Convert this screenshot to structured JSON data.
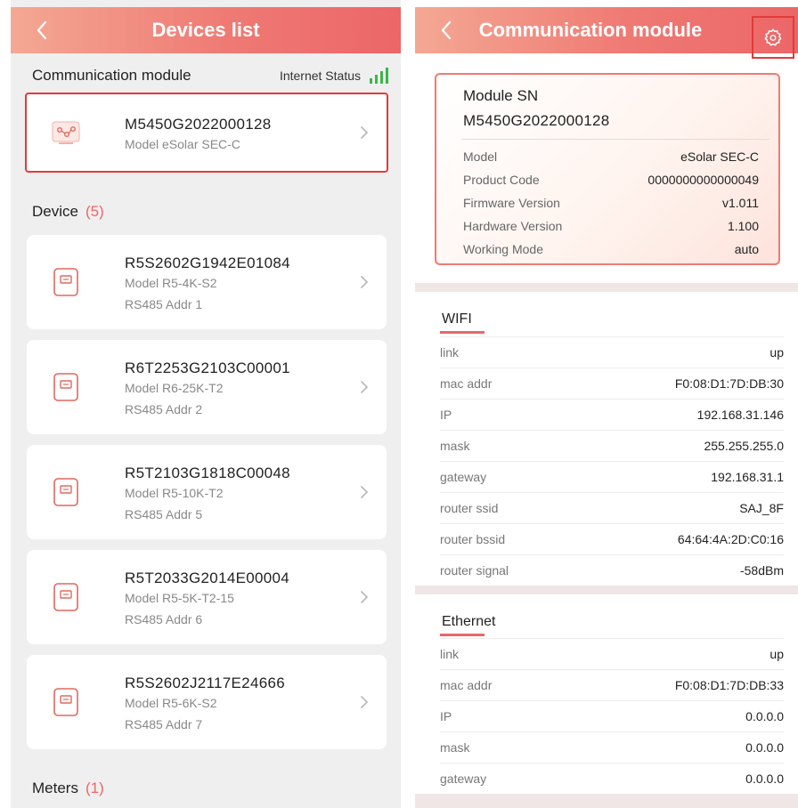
{
  "left": {
    "header": {
      "title": "Devices list"
    },
    "comm_section": {
      "title": "Communication module",
      "internet_status_label": "Internet Status"
    },
    "module": {
      "sn": "M5450G2022000128",
      "model": "Model  eSolar SEC-C"
    },
    "device_section": {
      "label": "Device",
      "count": "(5)"
    },
    "devices": [
      {
        "sn": "R5S2602G1942E01084",
        "model": "Model R5-4K-S2",
        "addr": "RS485 Addr  1"
      },
      {
        "sn": "R6T2253G2103C00001",
        "model": "Model R6-25K-T2",
        "addr": "RS485 Addr  2"
      },
      {
        "sn": "R5T2103G1818C00048",
        "model": "Model R5-10K-T2",
        "addr": "RS485 Addr  5"
      },
      {
        "sn": "R5T2033G2014E00004",
        "model": "Model R5-5K-T2-15",
        "addr": "RS485 Addr  6"
      },
      {
        "sn": "R5S2602J2117E24666",
        "model": "Model R5-6K-S2",
        "addr": "RS485 Addr  7"
      }
    ],
    "meters_section": {
      "label": "Meters",
      "count": "(1)"
    }
  },
  "right": {
    "header": {
      "title": "Communication module"
    },
    "info": {
      "sn_label": "Module SN",
      "sn_value": "M5450G2022000128",
      "fields": [
        {
          "key": "Model",
          "value": "eSolar SEC-C"
        },
        {
          "key": "Product Code",
          "value": "0000000000000049"
        },
        {
          "key": "Firmware Version",
          "value": "v1.011"
        },
        {
          "key": "Hardware Version",
          "value": "1.100"
        },
        {
          "key": "Working Mode",
          "value": "auto"
        }
      ]
    },
    "wifi": {
      "title": "WIFI",
      "rows": [
        {
          "key": "link",
          "value": "up"
        },
        {
          "key": "mac addr",
          "value": "F0:08:D1:7D:DB:30"
        },
        {
          "key": "IP",
          "value": "192.168.31.146"
        },
        {
          "key": "mask",
          "value": "255.255.255.0"
        },
        {
          "key": "gateway",
          "value": "192.168.31.1"
        },
        {
          "key": "router ssid",
          "value": "SAJ_8F"
        },
        {
          "key": "router bssid",
          "value": "64:64:4A:2D:C0:16"
        },
        {
          "key": "router signal",
          "value": "-58dBm"
        }
      ]
    },
    "ethernet": {
      "title": "Ethernet",
      "rows": [
        {
          "key": "link",
          "value": "up"
        },
        {
          "key": "mac addr",
          "value": "F0:08:D1:7D:DB:33"
        },
        {
          "key": "IP",
          "value": "0.0.0.0"
        },
        {
          "key": "mask",
          "value": "0.0.0.0"
        },
        {
          "key": "gateway",
          "value": "0.0.0.0"
        }
      ]
    }
  },
  "colors": {
    "accent": "#ec6668",
    "highlight_border": "#e23b3b",
    "signal_green": "#3ab64a"
  },
  "icons": {
    "back": "chevron-left-icon",
    "settings": "gear-icon",
    "module": "module-icon",
    "inverter": "inverter-icon",
    "row_chevron": "chevron-right-icon",
    "signal": "signal-bars-icon"
  }
}
